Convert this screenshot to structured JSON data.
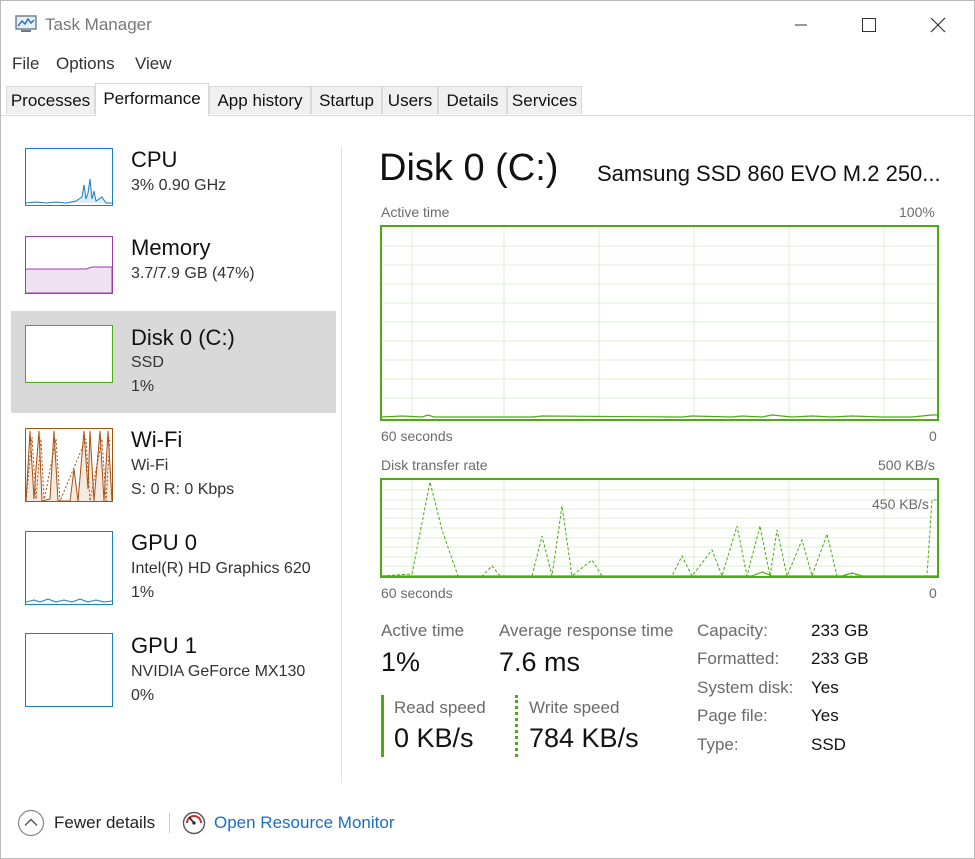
{
  "window": {
    "title": "Task Manager"
  },
  "menu": [
    "File",
    "Options",
    "View"
  ],
  "tabs": [
    {
      "label": "Processes"
    },
    {
      "label": "Performance"
    },
    {
      "label": "App history"
    },
    {
      "label": "Startup"
    },
    {
      "label": "Users"
    },
    {
      "label": "Details"
    },
    {
      "label": "Services"
    }
  ],
  "sidebar": {
    "items": [
      {
        "name": "CPU",
        "line1": "3%  0.90 GHz",
        "line2": "",
        "color": "#1a7fc4"
      },
      {
        "name": "Memory",
        "line1": "3.7/7.9 GB (47%)",
        "line2": "",
        "color": "#9b3fad"
      },
      {
        "name": "Disk 0 (C:)",
        "line1": "SSD",
        "line2": "1%",
        "color": "#4caa14"
      },
      {
        "name": "Wi-Fi",
        "line1": "Wi-Fi",
        "line2": "S: 0  R: 0 Kbps",
        "color": "#a74f0e"
      },
      {
        "name": "GPU 0",
        "line1": "Intel(R) HD Graphics 620",
        "line2": "1%",
        "color": "#1a7fc4"
      },
      {
        "name": "GPU 1",
        "line1": "NVIDIA GeForce MX130",
        "line2": "0%",
        "color": "#1a7fc4"
      }
    ]
  },
  "main": {
    "title": "Disk 0 (C:)",
    "model": "Samsung SSD 860 EVO M.2 250...",
    "graph1": {
      "label": "Active time",
      "max": "100%",
      "xlabel": "60 seconds",
      "min": "0"
    },
    "graph2": {
      "label": "Disk transfer rate",
      "max": "500 KB/s",
      "marker": "450 KB/s",
      "xlabel": "60 seconds",
      "min": "0"
    },
    "stats": {
      "active_time_label": "Active time",
      "active_time": "1%",
      "avg_response_label": "Average response time",
      "avg_response": "7.6 ms",
      "read_label": "Read speed",
      "read": "0 KB/s",
      "write_label": "Write speed",
      "write": "784 KB/s"
    },
    "info": [
      {
        "key": "Capacity:",
        "value": "233 GB"
      },
      {
        "key": "Formatted:",
        "value": "233 GB"
      },
      {
        "key": "System disk:",
        "value": "Yes"
      },
      {
        "key": "Page file:",
        "value": "Yes"
      },
      {
        "key": "Type:",
        "value": "SSD"
      }
    ]
  },
  "footer": {
    "fewer": "Fewer details",
    "monitor": "Open Resource Monitor"
  },
  "icons": [
    "task-manager-icon",
    "minimize-icon",
    "maximize-icon",
    "close-icon",
    "chevron-up-icon",
    "resource-monitor-icon"
  ],
  "colors": {
    "accent_disk": "#4caa14",
    "link": "#1a6fc4"
  }
}
